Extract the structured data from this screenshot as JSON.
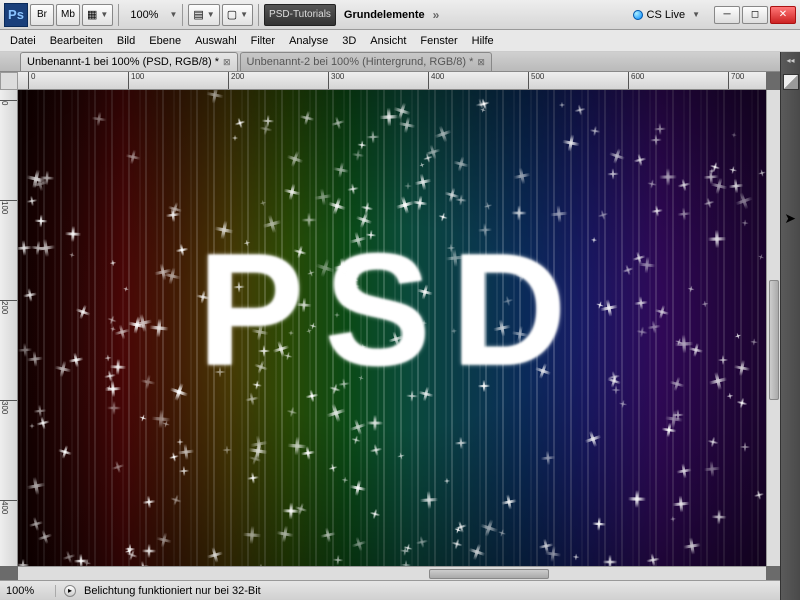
{
  "app": {
    "logo": "Ps",
    "zoom": "100%"
  },
  "workspace_buttons": {
    "psd_tutorials": "PSD-Tutorials",
    "grundelemente": "Grundelemente"
  },
  "cslive": {
    "label": "CS Live"
  },
  "toolbar_icons": {
    "br": "Br",
    "mb": "Mb"
  },
  "menu": {
    "datei": "Datei",
    "bearbeiten": "Bearbeiten",
    "bild": "Bild",
    "ebene": "Ebene",
    "auswahl": "Auswahl",
    "filter": "Filter",
    "analyse": "Analyse",
    "dd": "3D",
    "ansicht": "Ansicht",
    "fenster": "Fenster",
    "hilfe": "Hilfe"
  },
  "tabs": {
    "tab1": "Unbenannt-1 bei 100% (PSD, RGB/8) *",
    "tab2": "Unbenannt-2 bei 100% (Hintergrund, RGB/8) *"
  },
  "status": {
    "zoom": "100%",
    "message": "Belichtung funktioniert nur bei 32-Bit"
  },
  "canvas": {
    "text": "PSD"
  },
  "ruler": {
    "marks_h": [
      "0",
      "100",
      "200",
      "300",
      "400",
      "500",
      "600",
      "700"
    ],
    "marks_v": [
      "0",
      "100",
      "200",
      "300",
      "400"
    ]
  }
}
